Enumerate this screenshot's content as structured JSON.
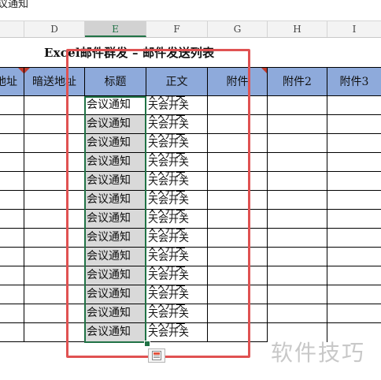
{
  "formula_bar": {
    "value": "议通知"
  },
  "columns": [
    {
      "letter": "D",
      "selected": false
    },
    {
      "letter": "E",
      "selected": true
    },
    {
      "letter": "F",
      "selected": false
    },
    {
      "letter": "G",
      "selected": false
    },
    {
      "letter": "H",
      "selected": false
    },
    {
      "letter": "I",
      "selected": false
    }
  ],
  "sheet_title": "Excel邮件群发 – 邮件发送列表",
  "headers": [
    "地址",
    "暗送地址",
    "标题",
    "正文",
    "附件",
    "附件2",
    "附件3"
  ],
  "rows": [
    {
      "title": "会议通知",
      "body_line1": "××开关",
      "body_line2": "天会开关"
    },
    {
      "title": "会议通知",
      "body_line1": "××开关",
      "body_line2": "天会开关"
    },
    {
      "title": "会议通知",
      "body_line1": "××开关",
      "body_line2": "天会开关"
    },
    {
      "title": "会议通知",
      "body_line1": "××开关",
      "body_line2": "天会开关"
    },
    {
      "title": "会议通知",
      "body_line1": "××开关",
      "body_line2": "天会开关"
    },
    {
      "title": "会议通知",
      "body_line1": "××开关",
      "body_line2": "天会开关"
    },
    {
      "title": "会议通知",
      "body_line1": "××开关",
      "body_line2": "天会开关"
    },
    {
      "title": "会议通知",
      "body_line1": "××开关",
      "body_line2": "天会开关"
    },
    {
      "title": "会议通知",
      "body_line1": "××开关",
      "body_line2": "天会开关"
    },
    {
      "title": "会议通知",
      "body_line1": "××开关",
      "body_line2": "天会开关"
    },
    {
      "title": "会议通知",
      "body_line1": "××开关",
      "body_line2": "天会开关"
    },
    {
      "title": "会议通知",
      "body_line1": "××开关",
      "body_line2": "天会开关"
    },
    {
      "title": "会议通知",
      "body_line1": "××开关",
      "body_line2": "天会开关"
    }
  ],
  "watermark": "软件技巧",
  "colors": {
    "header_bg": "#8eaadb",
    "selection": "#217346",
    "highlight": "#e05252"
  }
}
